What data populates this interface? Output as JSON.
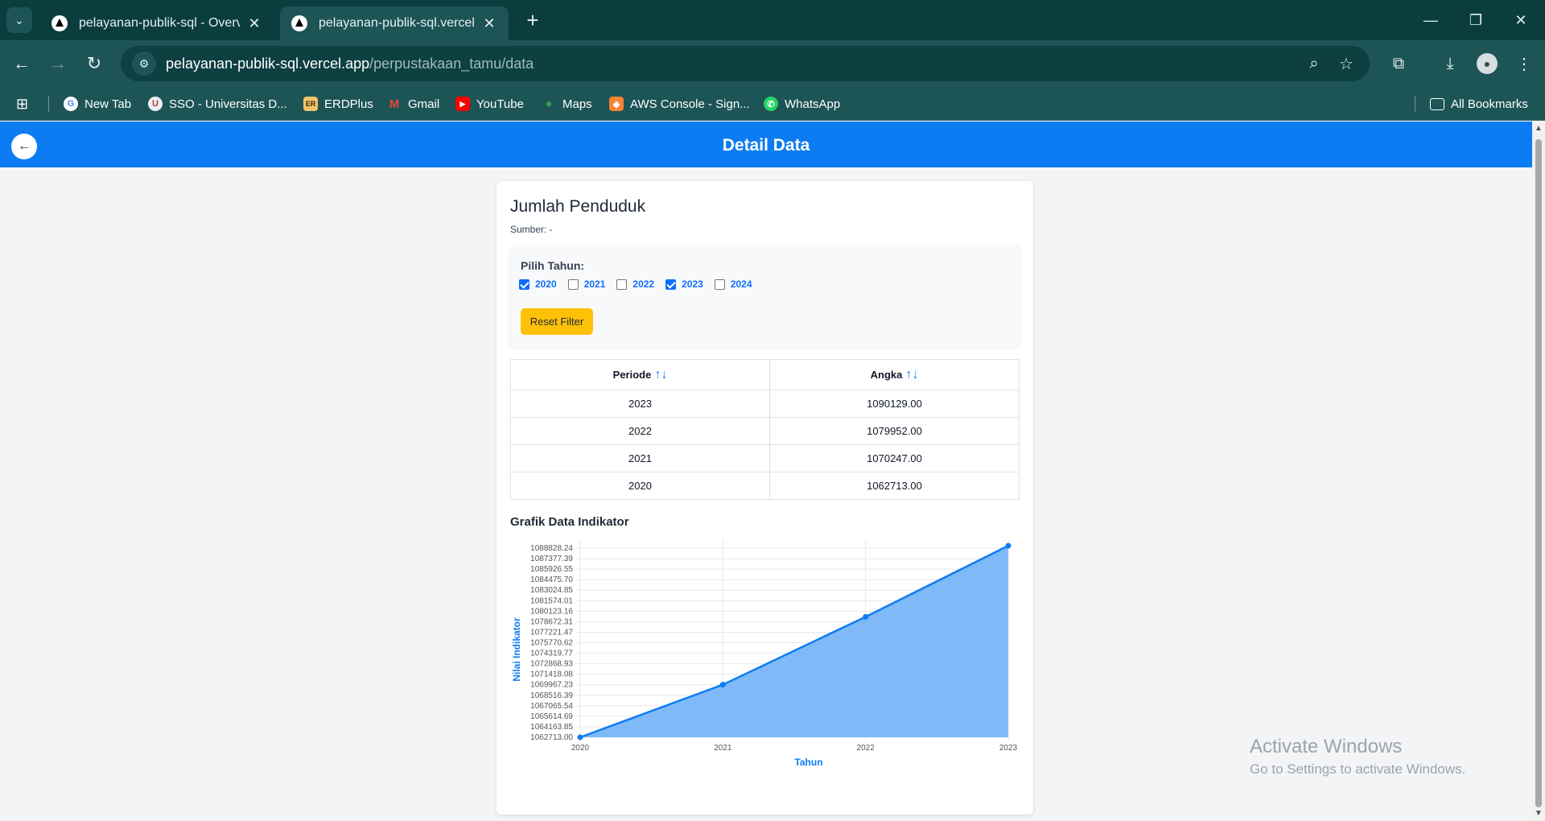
{
  "browser": {
    "tabs": [
      {
        "title": "pelayanan-publik-sql - Overview",
        "active": false
      },
      {
        "title": "pelayanan-publik-sql.vercel.app",
        "active": true
      }
    ],
    "url_host": "pelayanan-publik-sql.vercel.app",
    "url_path": "/perpustakaan_tamu/data",
    "bookmarks": [
      {
        "label": "New Tab",
        "color": "#ffffff"
      },
      {
        "label": "SSO - Universitas D...",
        "color": "#e9eef2"
      },
      {
        "label": "ERDPlus",
        "color": "#f2c36b"
      },
      {
        "label": "Gmail",
        "color": "#ea4335"
      },
      {
        "label": "YouTube",
        "color": "#ff0000"
      },
      {
        "label": "Maps",
        "color": "#34a853"
      },
      {
        "label": "AWS Console - Sign...",
        "color": "#f58534"
      },
      {
        "label": "WhatsApp",
        "color": "#25d366"
      }
    ],
    "all_bookmarks": "All Bookmarks"
  },
  "header": {
    "title": "Detail Data"
  },
  "card": {
    "title": "Jumlah Penduduk",
    "source": "Sumber: -"
  },
  "filter": {
    "label": "Pilih Tahun:",
    "years": [
      {
        "year": "2020",
        "checked": true
      },
      {
        "year": "2021",
        "checked": false
      },
      {
        "year": "2022",
        "checked": false
      },
      {
        "year": "2023",
        "checked": true
      },
      {
        "year": "2024",
        "checked": false
      }
    ],
    "reset_label": "Reset Filter"
  },
  "table": {
    "headers": [
      "Periode",
      "Angka"
    ],
    "sort_icon": "↑↓",
    "rows": [
      [
        "2023",
        "1090129.00"
      ],
      [
        "2022",
        "1079952.00"
      ],
      [
        "2021",
        "1070247.00"
      ],
      [
        "2020",
        "1062713.00"
      ]
    ]
  },
  "chart_title": "Grafik Data Indikator",
  "chart_data": {
    "type": "area",
    "x": [
      "2020",
      "2021",
      "2022",
      "2023"
    ],
    "series": [
      {
        "values": [
          1062713.0,
          1070247.0,
          1079952.0,
          1090129.0
        ]
      }
    ],
    "xlabel": "Tahun",
    "ylabel": "Nilai Indikator",
    "yticks": [
      "1088828.24",
      "1087377.39",
      "1085926.55",
      "1084475.70",
      "1083024.85",
      "1081574.01",
      "1080123.16",
      "1078672.31",
      "1077221.47",
      "1075770.62",
      "1074319.77",
      "1072868.93",
      "1071418.08",
      "1069967.23",
      "1068516.39",
      "1067065.54",
      "1065614.69",
      "1064163.85",
      "1062713.00"
    ],
    "ylim": [
      1062713.0,
      1090129.0
    ],
    "grid": true,
    "line_color": "#0d7cf2",
    "fill_color": "#78b5f7"
  },
  "watermark": {
    "line1": "Activate Windows",
    "line2": "Go to Settings to activate Windows."
  }
}
